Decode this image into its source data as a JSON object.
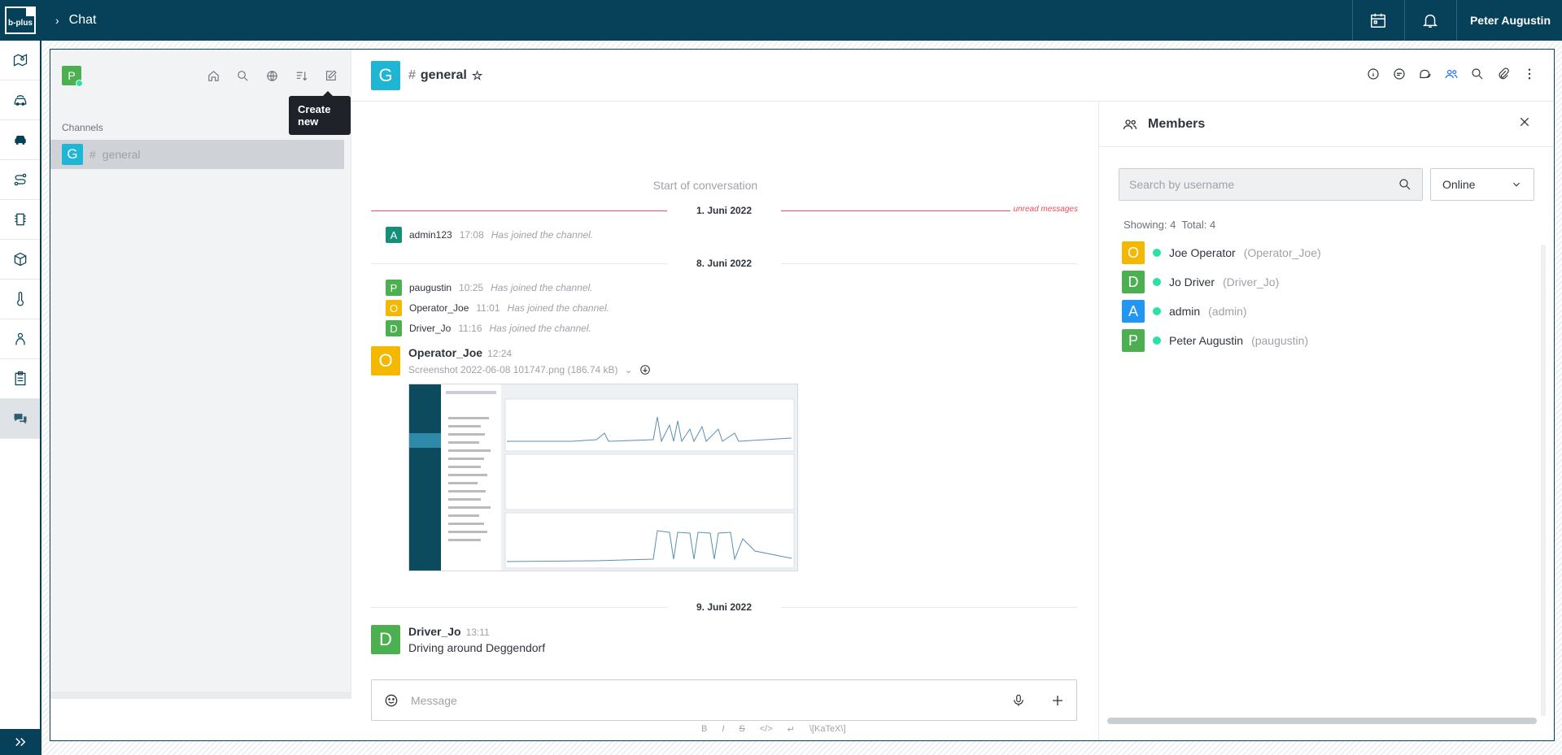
{
  "topbar": {
    "logo_text": "b-plus",
    "breadcrumb": "Chat",
    "user_name": "Peter Augustin",
    "icons": [
      "calendar-icon",
      "bell-icon"
    ]
  },
  "rail": {
    "items": [
      "map-icon",
      "vehicle-fleet-icon",
      "car-icon",
      "route-icon",
      "chip-icon",
      "cube-icon",
      "thermometer-icon",
      "driver-icon",
      "clipboard-icon",
      "chat-icon"
    ]
  },
  "sidebar": {
    "avatar_letter": "P",
    "section_label": "Channels",
    "tooltip": "Create new",
    "channels": [
      {
        "avatar": "G",
        "name": "general"
      }
    ]
  },
  "room": {
    "avatar": "G",
    "name": "general"
  },
  "messages": {
    "start_label": "Start of conversation",
    "unread_label": "unread messages",
    "dates": [
      "1. Juni 2022",
      "8. Juni 2022",
      "9. Juni 2022"
    ],
    "system": [
      {
        "avatar": "A",
        "user": "admin123",
        "time": "17:08",
        "text": "Has joined the channel."
      },
      {
        "avatar": "P",
        "user": "paugustin",
        "time": "10:25",
        "text": "Has joined the channel."
      },
      {
        "avatar": "O",
        "user": "Operator_Joe",
        "time": "11:01",
        "text": "Has joined the channel."
      },
      {
        "avatar": "D",
        "user": "Driver_Jo",
        "time": "11:16",
        "text": "Has joined the channel."
      }
    ],
    "attachment_msg": {
      "avatar": "O",
      "user": "Operator_Joe",
      "time": "12:24",
      "file": "Screenshot 2022-06-08 101747.png (186.74 kB)"
    },
    "text_msg": {
      "avatar": "D",
      "user": "Driver_Jo",
      "time": "13:11",
      "text": "Driving around Deggendorf"
    }
  },
  "composer": {
    "placeholder": "Message",
    "formatting": [
      "B",
      "I",
      "S",
      "</>",
      "↵",
      "\\[KaTeX\\]"
    ]
  },
  "members": {
    "title": "Members",
    "search_placeholder": "Search by username",
    "filter_value": "Online",
    "showing_label": "Showing: 4",
    "total_label": "Total: 4",
    "list": [
      {
        "avatar": "O",
        "color": "#f5b800",
        "name": "Joe Operator",
        "username": "(Operator_Joe)"
      },
      {
        "avatar": "D",
        "color": "#4caf50",
        "name": "Jo Driver",
        "username": "(Driver_Jo)"
      },
      {
        "avatar": "A",
        "color": "#2196f3",
        "name": "admin",
        "username": "(admin)"
      },
      {
        "avatar": "P",
        "color": "#4caf50",
        "name": "Peter Augustin",
        "username": "(paugustin)"
      }
    ]
  },
  "colors": {
    "brand": "#064159",
    "online": "#2de0a5",
    "unread": "#e8505b",
    "avatar_general": "#1fb6d4",
    "avatar_a": "#14907a",
    "avatar_p": "#4caf50",
    "avatar_o": "#f5b800",
    "avatar_d": "#4caf50"
  }
}
